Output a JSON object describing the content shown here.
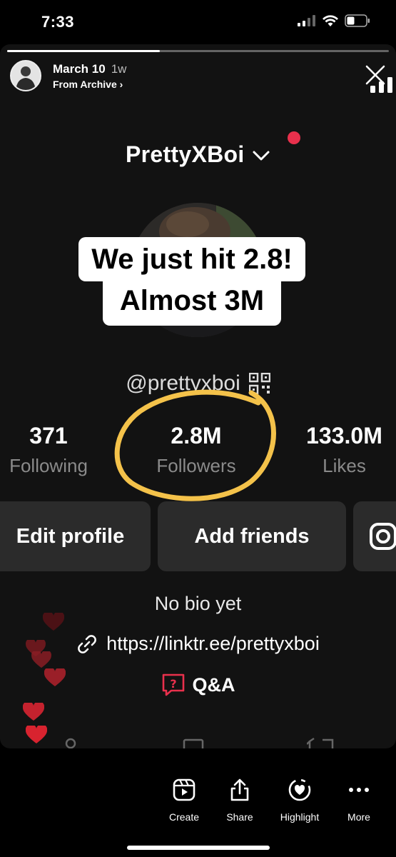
{
  "status_bar": {
    "time": "7:33"
  },
  "story": {
    "progress": 0.4,
    "date": "March 10",
    "ago": "1w",
    "source": "From Archive",
    "source_chevron": "›"
  },
  "profile": {
    "username": "PrettyXBoi",
    "handle": "@prettyxboi",
    "stats": [
      {
        "value": "371",
        "label": "Following"
      },
      {
        "value": "2.8M",
        "label": "Followers"
      },
      {
        "value": "133.0M",
        "label": "Likes"
      }
    ],
    "buttons": {
      "edit": "Edit profile",
      "add_friends": "Add friends"
    },
    "bio": "No bio yet",
    "link": "https://linktr.ee/prettyxboi",
    "qa": "Q&A"
  },
  "overlay": {
    "line1": "We just hit 2.8!",
    "line2": "Almost 3M"
  },
  "bottom_actions": [
    {
      "label": "Create",
      "icon": "create-icon"
    },
    {
      "label": "Share",
      "icon": "share-icon"
    },
    {
      "label": "Highlight",
      "icon": "highlight-icon"
    },
    {
      "label": "More",
      "icon": "more-icon"
    }
  ],
  "colors": {
    "annotation_circle": "#f4c24a",
    "red_dot": "#e8304c",
    "heart": "#c4222e",
    "qa_accent": "#e8304c"
  }
}
